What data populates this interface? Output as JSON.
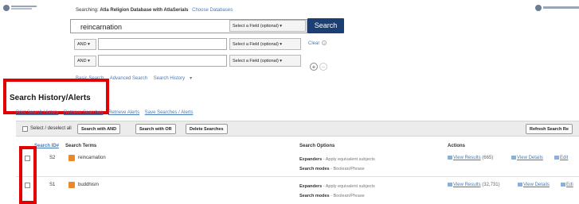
{
  "header": {
    "searching_label": "Searching:",
    "database": "Atla Religion Database with AtlaSerials",
    "choose_databases": "Choose Databases"
  },
  "search": {
    "row1_value": "reincarnation",
    "field_select": "Select a Field (optional)",
    "search_button": "Search",
    "bool_op": "AND",
    "clear_link": "Clear",
    "help_icon": "?"
  },
  "adv_links": [
    "Basic Search",
    "Advanced Search",
    "Search History"
  ],
  "history": {
    "title": "Search History/Alerts",
    "links": [
      "Print Search History",
      "Retrieve Searches",
      "Retrieve Alerts",
      "Save Searches / Alerts"
    ],
    "toolbar": {
      "select_all": "Select / deselect all",
      "btn_and": "Search with AND",
      "btn_or": "Search with OR",
      "btn_delete": "Delete Searches",
      "btn_refresh": "Refresh Search Re"
    },
    "columns": {
      "search_id": "Search ID#",
      "terms": "Search Terms",
      "options": "Search Options",
      "actions": "Actions"
    },
    "rows": [
      {
        "id": "S2",
        "term": "reincarnation",
        "opt1_label": "Expanders",
        "opt1_value": "- Apply equivalent subjects",
        "opt2_label": "Search modes",
        "opt2_value": "- Boolean/Phrase",
        "view_results": "View Results",
        "count": "(665)",
        "view_details": "View Details",
        "edit": "Edit"
      },
      {
        "id": "S1",
        "term": "buddhism",
        "opt1_label": "Expanders",
        "opt1_value": "- Apply equivalent subjects",
        "opt2_label": "Search modes",
        "opt2_value": "- Boolean/Phrase",
        "view_results": "View Results",
        "count": "(32,731)",
        "view_details": "View Details",
        "edit": "Edi"
      }
    ]
  },
  "colors": {
    "search_button": "#1b3f72",
    "link": "#4a7ab5",
    "highlight": "#e20000",
    "doc_icon": "#e8892a"
  }
}
